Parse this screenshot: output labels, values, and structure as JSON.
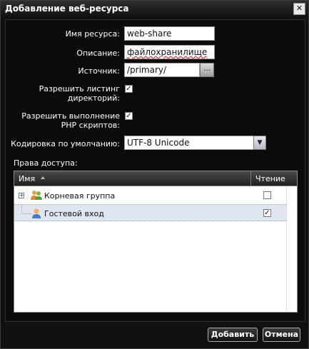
{
  "dialog": {
    "title": "Добавление веб-ресурса",
    "close_glyph": "✕"
  },
  "form": {
    "name_label": "Имя ресурса:",
    "name_value": "web-share",
    "description_label": "Описание:",
    "description_value": "файлохранилище",
    "source_label": "Источник:",
    "source_value": "/primary/",
    "browse_glyph": "...",
    "dir_listing_label_line1": "Разрешить листинг",
    "dir_listing_label_line2": "директорий:",
    "dir_listing_checked": true,
    "php_label_line1": "Разрешить выполнение",
    "php_label_line2": "PHP скриптов:",
    "php_checked": true,
    "encoding_label": "Кодировка по умолчанию:",
    "encoding_value": "UTF-8 Unicode",
    "check_glyph": "✓",
    "dropdown_glyph": "▼"
  },
  "access": {
    "label": "Права доступа:",
    "columns": {
      "name": "Имя",
      "read": "Чтение"
    },
    "rows": [
      {
        "name": "Корневая группа",
        "read": false,
        "expander": "+"
      },
      {
        "name": "Гостевой вход",
        "read": true,
        "check": "✓"
      }
    ]
  },
  "buttons": {
    "add": "Добавить",
    "cancel": "Отмена"
  },
  "colors": {
    "background": "#101010",
    "selected_row": "#dfe6f0"
  }
}
